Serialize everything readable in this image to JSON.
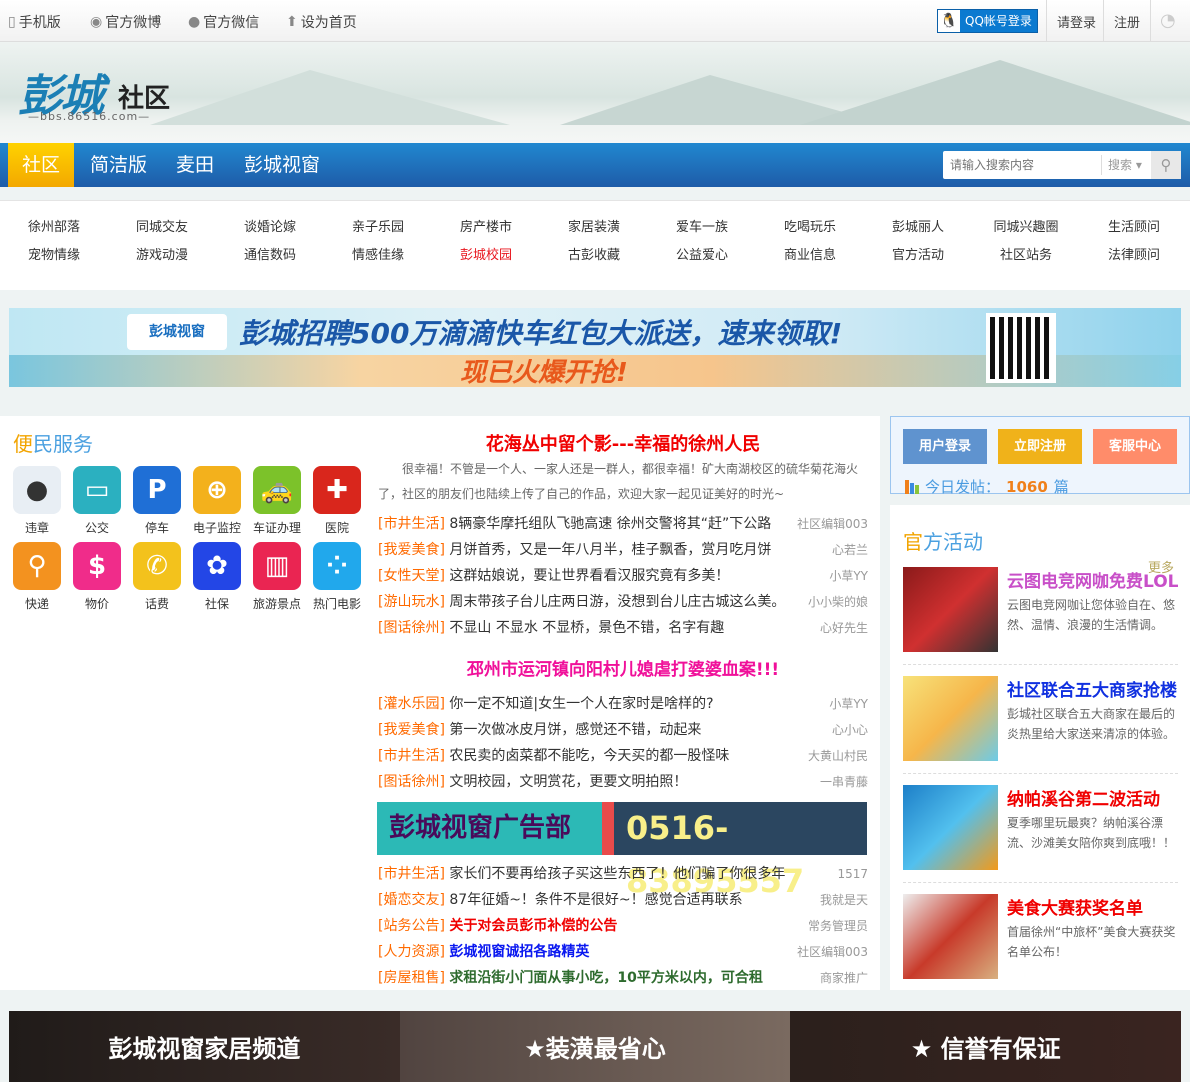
{
  "topbar": {
    "links": [
      {
        "icon": "phone-icon",
        "label": "手机版"
      },
      {
        "icon": "weibo-icon",
        "label": "官方微博"
      },
      {
        "icon": "wechat-icon",
        "label": "官方微信"
      },
      {
        "icon": "home-icon",
        "label": "设为首页"
      }
    ],
    "qq_login": "QQ帐号登录",
    "login": "请登录",
    "register": "注册",
    "rss_icon": "rss-icon"
  },
  "header": {
    "logo_text": "彭城",
    "logo_sub": "社区",
    "logo_url": "—bbs.86516.com—"
  },
  "nav": {
    "items": [
      "社区",
      "简洁版",
      "麦田",
      "彭城视窗"
    ],
    "active": 0,
    "search_placeholder": "请输入搜索内容",
    "search_type": "搜索"
  },
  "categories": {
    "row1": [
      "徐州部落",
      "同城交友",
      "谈婚论嫁",
      "亲子乐园",
      "房产楼市",
      "家居装潢",
      "爱车一族",
      "吃喝玩乐",
      "彭城丽人",
      "同城兴趣圈",
      "生活顾问"
    ],
    "row2": [
      "宠物情缘",
      "游戏动漫",
      "通信数码",
      "情感佳缘",
      "彭城校园",
      "古彭收藏",
      "公益爱心",
      "商业信息",
      "官方活动",
      "社区站务",
      "法律顾问"
    ],
    "highlight": "彭城校园"
  },
  "banner": {
    "brand": "彭城视窗",
    "line1": "彭城招聘500万滴滴快车红包大派送，速来领取!",
    "line2": "现已火爆开抢!"
  },
  "services": {
    "title_a": "便",
    "title_b": "民服务",
    "items": [
      {
        "label": "违章",
        "icon": "traffic-light-icon",
        "color": "#e8eef4"
      },
      {
        "label": "公交",
        "icon": "bus-icon",
        "color": "#2bb0c0"
      },
      {
        "label": "停车",
        "icon": "parking-icon",
        "color": "#1f6fd6"
      },
      {
        "label": "电子监控",
        "icon": "crosshair-icon",
        "color": "#f3b11c"
      },
      {
        "label": "车证办理",
        "icon": "car-icon",
        "color": "#7cc22a"
      },
      {
        "label": "医院",
        "icon": "hospital-icon",
        "color": "#d9261c"
      },
      {
        "label": "快递",
        "icon": "magnifier-icon",
        "color": "#f3921f"
      },
      {
        "label": "物价",
        "icon": "money-bag-icon",
        "color": "#f02c8a"
      },
      {
        "label": "话费",
        "icon": "phone-handset-icon",
        "color": "#f3c21c"
      },
      {
        "label": "社保",
        "icon": "flower-icon",
        "color": "#2346e6"
      },
      {
        "label": "旅游景点",
        "icon": "scenery-icon",
        "color": "#ea2552"
      },
      {
        "label": "热门电影",
        "icon": "film-reel-icon",
        "color": "#21a8ec"
      }
    ]
  },
  "news": {
    "headline": "花海丛中留个影---幸福的徐州人民",
    "summary": "很幸福！不管是一个人、一家人还是一群人，都很幸福！矿大南湖校区的硫华菊花海火了，社区的朋友们也陆续上传了自己的作品，欢迎大家一起见证美好的时光~",
    "list1": [
      {
        "tag": "[市井生活]",
        "title": "8辆豪华摩托组队飞驰高速 徐州交警将其“赶”下公路",
        "author": "社区编辑003"
      },
      {
        "tag": "[我爱美食]",
        "title": "月饼首秀，又是一年八月半，桂子飘香，赏月吃月饼",
        "author": "心若兰"
      },
      {
        "tag": "[女性天堂]",
        "title": "这群姑娘说，要让世界看看汉服究竟有多美！",
        "author": "小草YY"
      },
      {
        "tag": "[游山玩水]",
        "title": "周末带孩子台儿庄两日游，没想到台儿庄古城这么美。",
        "author": "小小柴的娘"
      },
      {
        "tag": "[图话徐州]",
        "title": "不显山 不显水 不显桥，景色不错，名字有趣",
        "author": "心好先生"
      }
    ],
    "headline2": "邳州市运河镇向阳村儿媳虐打婆婆血案!!!",
    "list2": [
      {
        "tag": "[灌水乐园]",
        "title": "你一定不知道|女生一个人在家时是啥样的?",
        "author": "小草YY"
      },
      {
        "tag": "[我爱美食]",
        "title": "第一次做冰皮月饼，感觉还不错，动起来",
        "author": "心小心"
      },
      {
        "tag": "[市井生活]",
        "title": "农民卖的卤菜都不能吃，今天买的都一股怪味",
        "author": "大黄山村民"
      },
      {
        "tag": "[图话徐州]",
        "title": "文明校园，文明赏花，更要文明拍照！",
        "author": "一串青藤"
      }
    ],
    "ad_left": "彭城视窗广告部",
    "ad_right": "0516-83895557",
    "list3": [
      {
        "tag": "[市井生活]",
        "title": "家长们不要再给孩子买这些东西了！他们骗了你很多年",
        "author": "1517",
        "color": "#333"
      },
      {
        "tag": "[婚恋交友]",
        "title": "87年征婚~！条件不是很好~！感觉合适再联系",
        "author": "我就是天",
        "color": "#333"
      },
      {
        "tag": "[站务公告]",
        "title": "关于对会员彭币补偿的公告",
        "author": "常务管理员",
        "color": "#f00000"
      },
      {
        "tag": "[人力资源]",
        "title": "彭城视窗诚招各路精英",
        "author": "社区编辑003",
        "color": "#0a18f0"
      },
      {
        "tag": "[房屋租售]",
        "title": "求租沿街小门面从事小吃，10平方米以内，可合租",
        "author": "商家推广",
        "color": "#2e6b2e"
      }
    ]
  },
  "userbox": {
    "login": "用户登录",
    "register": "立即注册",
    "service": "客服中心",
    "today_label": "今日发帖：",
    "today_count": "1060",
    "today_unit": "篇"
  },
  "activities": {
    "title_a": "官",
    "title_b": "方活动",
    "more": "更多",
    "items": [
      {
        "title": "云图电竞网咖免费LOL",
        "desc": "云图电竞网咖让您体验自在、悠然、温情、浪漫的生活情调。",
        "color": "#c84fc8"
      },
      {
        "title": "社区联合五大商家抢楼",
        "desc": "彭城社区联合五大商家在最后的炎热里给大家送来清凉的体验。",
        "color": "#1030e0"
      },
      {
        "title": "纳帕溪谷第二波活动",
        "desc": "夏季哪里玩最爽？纳帕溪谷漂流、沙滩美女陪你爽到底哦！！",
        "color": "#f00000"
      },
      {
        "title": "美食大赛获奖名单",
        "desc": "首届徐州“中旅杯”美食大赛获奖名单公布！",
        "color": "#f00000"
      }
    ]
  },
  "bottom_banner": [
    "彭城视窗家居频道",
    "★装潢最省心",
    "★ 信誉有保证"
  ]
}
